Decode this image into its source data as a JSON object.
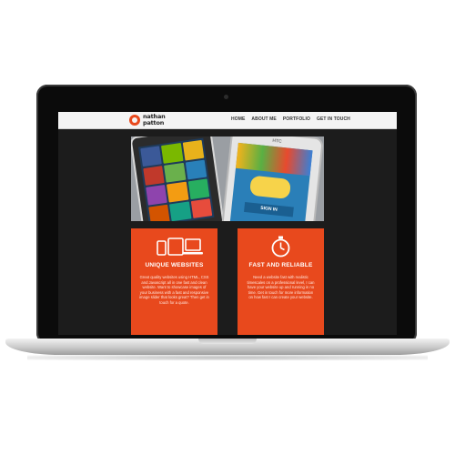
{
  "site": {
    "logo_line1": "nathan",
    "logo_line2": "patton",
    "nav": [
      "HOME",
      "ABOUT ME",
      "PORTFOLIO",
      "GET IN TOUCH"
    ]
  },
  "hero": {
    "phone_brand": "HTC",
    "sign_in_label": "SIGN IN"
  },
  "cards": [
    {
      "title": "UNIQUE WEBSITES",
      "icon": "devices-icon",
      "text": "Great quality websites using HTML, CSS and Javascript all in one fast and clean website. Want to showcase images of your business with a fast and responsive image slider that looks great? Then get in touch for a quote."
    },
    {
      "title": "FAST AND RELIABLE",
      "icon": "stopwatch-icon",
      "text": "Need a website fast with realistic timescales on a professional level, I can have your website up and running in no time. Get in touch for more information on how fast I can create your website."
    }
  ],
  "colors": {
    "accent": "#e8491d",
    "screen_bg": "#1c1c1c",
    "nav_bg": "#f4f4f4"
  }
}
